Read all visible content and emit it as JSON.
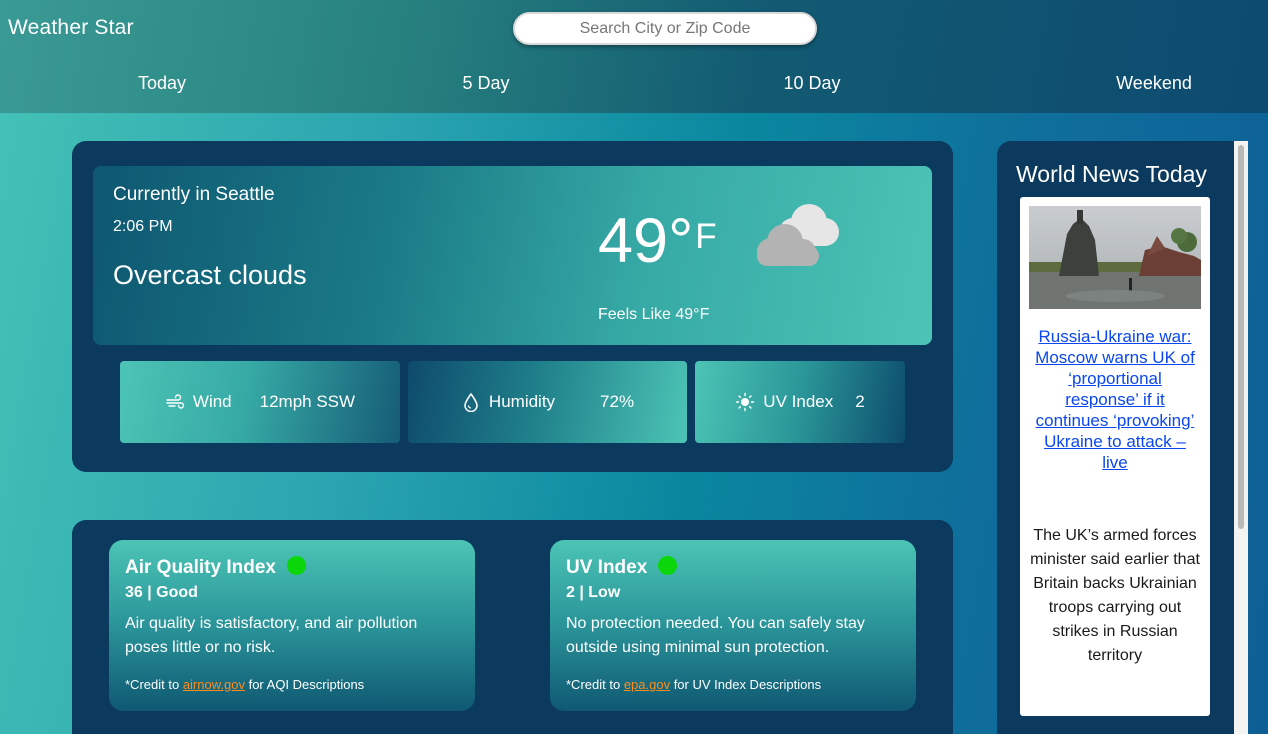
{
  "header": {
    "title": "Weather Star",
    "search_placeholder": "Search City or Zip Code",
    "tabs": [
      "Today",
      "5 Day",
      "10 Day",
      "Weekend"
    ]
  },
  "current": {
    "title": "Currently in Seattle",
    "time": "2:06 PM",
    "description": "Overcast clouds",
    "temperature": "49°",
    "unit": "F",
    "feels_like": "Feels Like 49°F",
    "icon": "cloud-icon"
  },
  "stats": {
    "wind": {
      "label": "Wind",
      "value": "12mph SSW",
      "icon": "wind-icon"
    },
    "humidity": {
      "label": "Humidity",
      "value": "72%",
      "icon": "droplet-icon"
    },
    "uv": {
      "label": "UV Index",
      "value": "2",
      "icon": "sun-icon"
    }
  },
  "indexes": {
    "aqi": {
      "title": "Air Quality Index",
      "value": "36 | Good",
      "description": "Air quality is satisfactory, and air pollution poses little or no risk.",
      "credit_prefix": "*Credit to ",
      "credit_link": "airnow.gov",
      "credit_suffix": " for AQI Descriptions",
      "status_color": "#0ad60a"
    },
    "uv": {
      "title": "UV Index",
      "value": "2 | Low",
      "description": "No protection needed. You can safely stay outside using minimal sun protection.",
      "credit_prefix": "*Credit to ",
      "credit_link": "epa.gov",
      "credit_suffix": " for UV Index Descriptions",
      "status_color": "#0ad60a"
    }
  },
  "news": {
    "heading": "World News Today",
    "article": {
      "headline": "Russia-Ukraine war: Moscow warns UK of ‘proportional response’ if it continues ‘provoking’ Ukraine to attack – live",
      "summary": "The UK’s armed forces minister said earlier that Britain backs Ukrainian troops carrying out strikes in Russian territory"
    }
  },
  "colors": {
    "panel": "#0b3a5e",
    "link": "#0a47f0",
    "credit_link": "#ff8c1a",
    "status_good": "#0ad60a"
  }
}
